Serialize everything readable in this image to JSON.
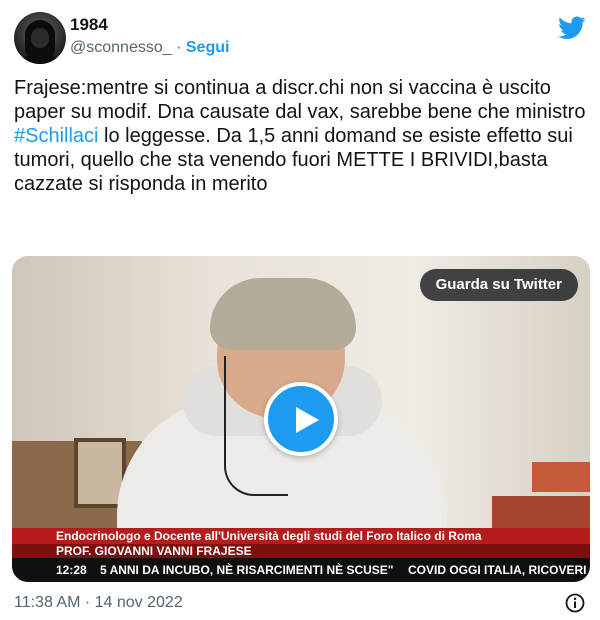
{
  "author": {
    "display_name": "1984",
    "handle": "@sconnesso_",
    "separator": "·",
    "follow_label": "Segui"
  },
  "icons": {
    "logo": "twitter-bird-icon",
    "play": "play-icon",
    "info": "info-icon"
  },
  "tweet": {
    "text_before": "Frajese:mentre si continua a discr.chi non si vaccina è uscito paper su modif.  Dna causate dal vax, sarebbe bene che ministro ",
    "hashtag": "#Schillaci",
    "text_after": " lo leggesse. Da 1,5 anni domand se esiste effetto sui tumori, quello che sta venendo fuori METTE I BRIVIDI,basta cazzate si risponda in merito"
  },
  "media": {
    "watch_label": "Guarda su Twitter",
    "lower_third": {
      "line1": "Endocrinologo e Docente all'Università degli studi del Foro Italico di Roma",
      "line2": "PROF. GIOVANNI VANNI FRAJESE",
      "time": "12:28",
      "ticker_left": "5 ANNI DA INCUBO, NÈ RISARCIMENTI NÈ SCUSE\"",
      "ticker_right": "COVID OGGI ITALIA, RICOVERI IN"
    }
  },
  "footer": {
    "timestamp": "11:38 AM · 14 nov 2022"
  },
  "colors": {
    "accent": "#1d9bf0",
    "text": "#0f1419",
    "muted": "#536471"
  }
}
